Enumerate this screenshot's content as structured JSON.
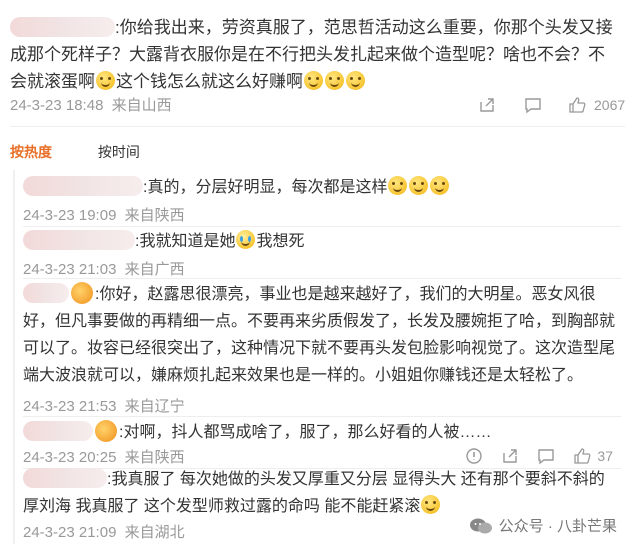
{
  "main_comment": {
    "text_1": ":你给我出来，劳资真服了，范思哲活动这么重要，你那个头发又接成那个死样子？大露背衣服你是在不行把头发扎起来做个造型呢？啥也不会？不会就滚蛋啊",
    "text_2": "这个钱怎么就这么好赚啊",
    "date": "24-3-23 18:48",
    "source": "来自山西",
    "like_count": "2067"
  },
  "tabs": {
    "hot": "按热度",
    "time": "按时间"
  },
  "replies": [
    {
      "text": ":真的，分层好明显，每次都是这样",
      "date": "24-3-23 19:09",
      "source": "来自陕西"
    },
    {
      "text_a": ":我就知道是她",
      "text_b": "我想死",
      "date": "24-3-23 21:03",
      "source": "来自广西"
    },
    {
      "text": ":你好，赵露思很漂亮，事业也是越来越好了，我们的大明星。恶女风很好，但凡事要做的再精细一点。不要再来劣质假发了，长发及腰婉拒了哈，到胸部就可以了。妆容已经很突出了，这种情况下就不要再头发包脸影响视觉了。这次造型尾端大波浪就可以，嫌麻烦扎起来效果也是一样的。小姐姐你赚钱还是太轻松了。",
      "date": "24-3-23 21:53",
      "source": "来自辽宁"
    },
    {
      "text": ":对啊，抖人都骂成啥了，服了，那么好看的人被……",
      "date": "24-3-23 20:25",
      "source": "来自陕西",
      "like_count": "37"
    },
    {
      "text": ":我真服了 每次她做的头发又厚重又分层 显得头大 还有那个要斜不斜的厚刘海 我真服了 这个发型师救过露的命吗 能不能赶紧滚",
      "date": "24-3-23 21:09",
      "source": "来自湖北"
    }
  ],
  "watermark": {
    "label": "公众号 · 八卦芒果"
  },
  "colors": {
    "accent": "#e8712a",
    "meta": "#999999",
    "text": "#333333"
  }
}
